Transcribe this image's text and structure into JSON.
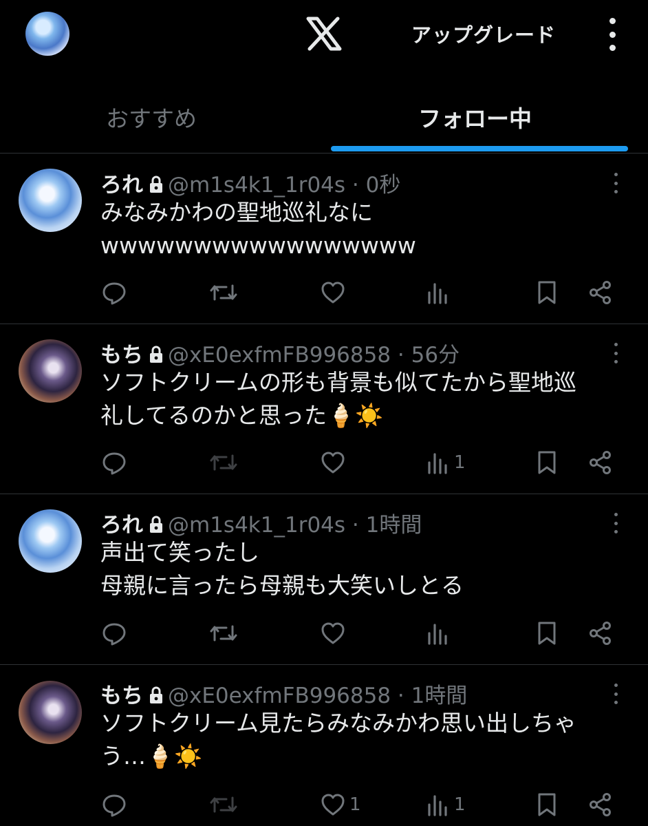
{
  "header": {
    "upgrade_label": "アップグレード"
  },
  "tabs": [
    {
      "label": "おすすめ",
      "active": false
    },
    {
      "label": "フォロー中",
      "active": true
    }
  ],
  "accent_color": "#1d9bf0",
  "posts": [
    {
      "name": "ろれ",
      "meta": "@m1s4k1_1r04s · 0秒",
      "text": "みなみかわの聖地巡礼なに\nwwwwwwwwwwwwwwwww",
      "views": ""
    },
    {
      "name": "もち",
      "meta": "@xE0exfmFB996858 · 56分",
      "text": "ソフトクリームの形も背景も似てたから聖地巡\n礼してるのかと思った🍦☀️",
      "views": "1"
    },
    {
      "name": "ろれ",
      "meta": "@m1s4k1_1r04s · 1時間",
      "text": "声出て笑ったし\n母親に言ったら母親も大笑いしとる",
      "views": ""
    },
    {
      "name": "もち",
      "meta": "@xE0exfmFB996858 · 1時間",
      "text": "ソフトクリーム見たらみなみかわ思い出しちゃ\nう…🍦☀️",
      "likes": "1",
      "views": "1"
    }
  ]
}
